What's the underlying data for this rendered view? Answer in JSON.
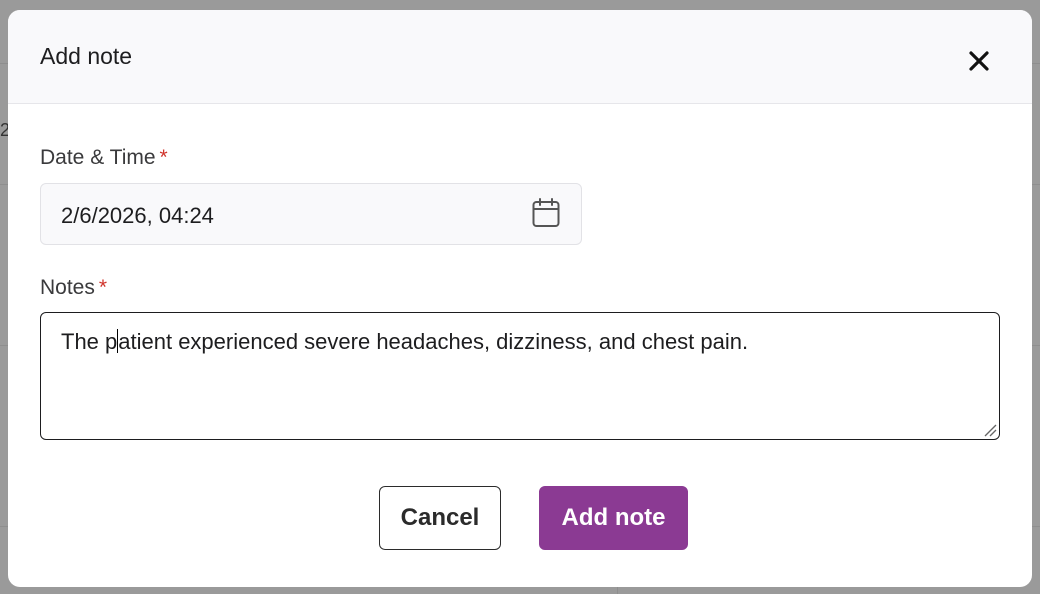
{
  "background": {
    "partial_glyph": "2"
  },
  "modal": {
    "title": "Add note",
    "close_icon": "close-icon",
    "date_field": {
      "label": "Date & Time",
      "required_mark": "*",
      "value": "2/6/2026, 04:24",
      "icon": "calendar-icon"
    },
    "notes_field": {
      "label": "Notes",
      "required_mark": "*",
      "value_before_caret": "The p",
      "value_after_caret": "atient experienced severe headaches, dizziness, and chest pain."
    },
    "buttons": {
      "cancel_label": "Cancel",
      "submit_label": "Add note"
    }
  },
  "colors": {
    "primary": "#8b3a93",
    "required": "#d0342c",
    "overlay": "#9a9a9a"
  }
}
